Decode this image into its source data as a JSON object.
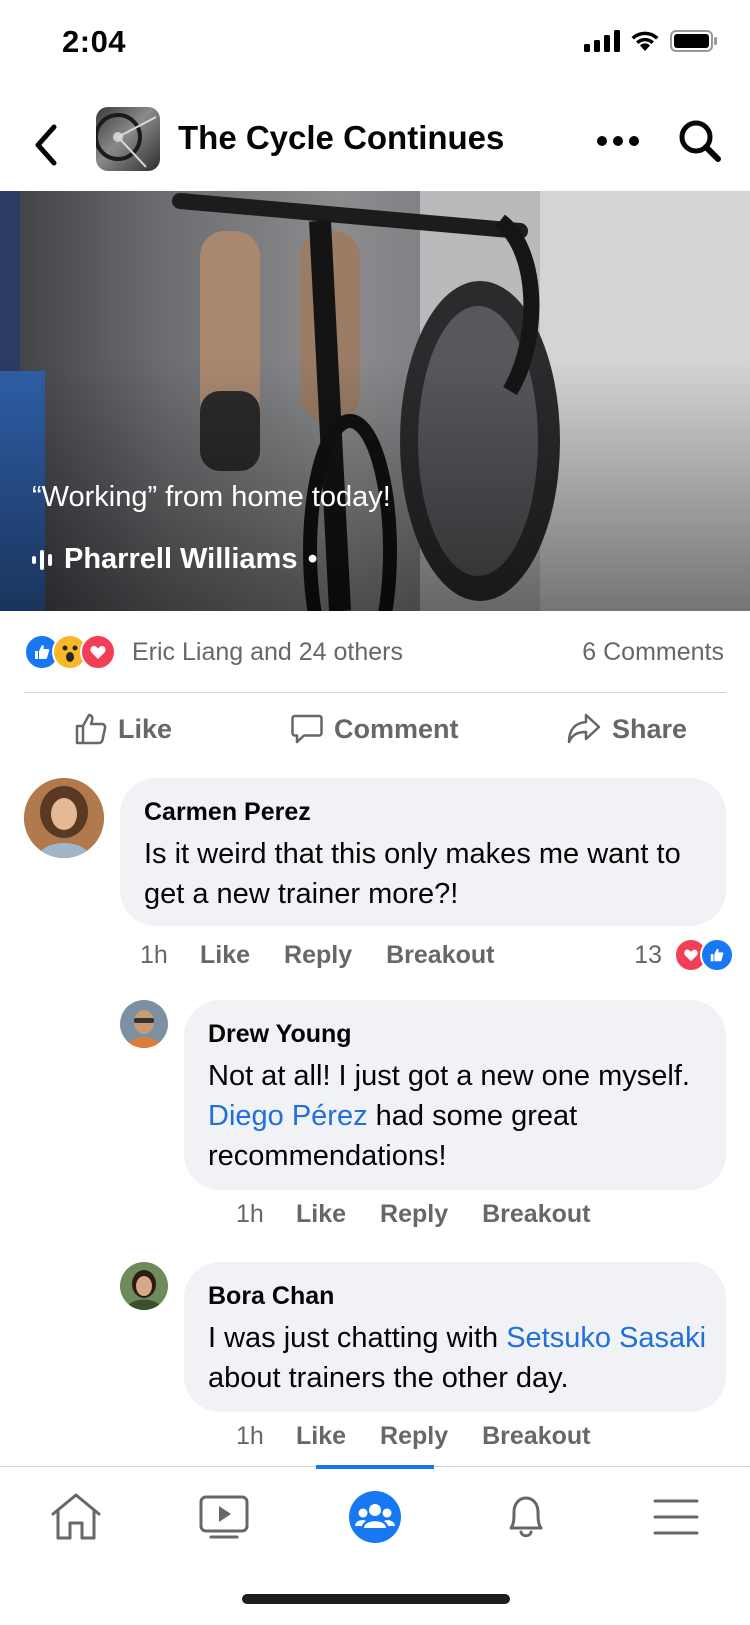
{
  "status_bar": {
    "time": "2:04"
  },
  "header": {
    "title": "The Cycle Continues"
  },
  "post": {
    "caption": "“Working” from home today!",
    "author": "Pharrell Williams",
    "author_suffix": "•",
    "reactions_text": "Eric Liang and 24 others",
    "comments_count": "6 Comments",
    "actions": {
      "like": "Like",
      "comment": "Comment",
      "share": "Share"
    }
  },
  "comments": [
    {
      "name": "Carmen Perez",
      "text": "Is it weird that this only makes me want to get a new trainer more?!",
      "time": "1h",
      "like": "Like",
      "reply": "Reply",
      "breakout": "Breakout",
      "reaction_count": "13"
    },
    {
      "name": "Drew Young",
      "text_before": "Not at all! I just got a new one myself. ",
      "mention": "Diego Pérez",
      "text_after": " had some great recommendations!",
      "time": "1h",
      "like": "Like",
      "reply": "Reply",
      "breakout": "Breakout"
    },
    {
      "name": "Bora Chan",
      "text_before": "I was just chatting with ",
      "mention": "Setsuko Sasaki",
      "text_after": " about trainers the other day.",
      "time": "1h",
      "like": "Like",
      "reply": "Reply",
      "breakout": "Breakout"
    }
  ],
  "bottom_nav": {
    "items": [
      "home-icon",
      "video-icon",
      "groups-icon",
      "notifications-icon",
      "menu-icon"
    ],
    "active": "groups-icon"
  },
  "colors": {
    "brand": "#1877f2",
    "link": "#216fdb",
    "bubble": "#f0f2f5",
    "secondary_text": "#65676b"
  }
}
